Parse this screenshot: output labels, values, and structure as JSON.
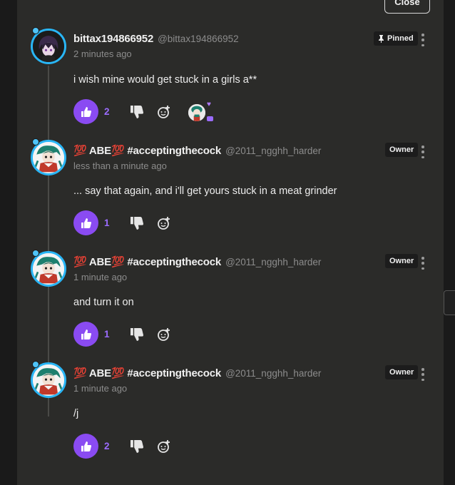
{
  "header": {
    "close_label": "Close"
  },
  "comments": [
    {
      "author": "bittax194866952",
      "handle": "@bittax194866952",
      "time": "2 minutes ago",
      "text": "i wish mine would get stuck in a girls a**",
      "tag": "Pinned",
      "likes": "2",
      "avatar_icon": "dark-anime-avatar"
    },
    {
      "author": "💯 ABE💯 #acceptingthecock",
      "handle": "@2011_ngghh_harder",
      "time": "less than a minute ago",
      "text": "... say that again, and i'll get yours stuck in a meat grinder",
      "tag": "Owner",
      "likes": "1",
      "avatar_icon": "teal-character-avatar"
    },
    {
      "author": "💯 ABE💯 #acceptingthecock",
      "handle": "@2011_ngghh_harder",
      "time": "1 minute ago",
      "text": "and turn it on",
      "tag": "Owner",
      "likes": "1",
      "avatar_icon": "teal-character-avatar"
    },
    {
      "author": "💯 ABE💯 #acceptingthecock",
      "handle": "@2011_ngghh_harder",
      "time": "1 minute ago",
      "text": "/j",
      "tag": "Owner",
      "likes": "2",
      "avatar_icon": "teal-character-avatar"
    }
  ],
  "colors": {
    "accent": "#8a4bf2",
    "panel": "#2b2b29",
    "avatar_ring": "#29b6f6"
  }
}
